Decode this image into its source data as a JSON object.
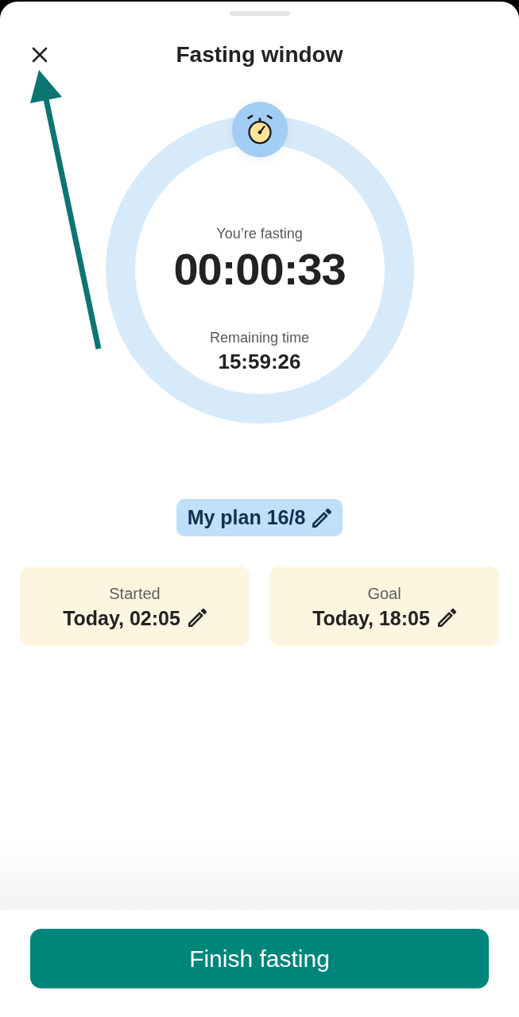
{
  "sheet": {
    "title": "Fasting window"
  },
  "timer": {
    "status_label": "You’re fasting",
    "elapsed": "00:00:33",
    "remaining_label": "Remaining time",
    "remaining": "15:59:26"
  },
  "plan": {
    "label": "My plan 16/8"
  },
  "times": [
    {
      "label": "Started",
      "value": "Today, 02:05"
    },
    {
      "label": "Goal",
      "value": "Today, 18:05"
    }
  ],
  "primary_button": {
    "label": "Finish fasting"
  }
}
